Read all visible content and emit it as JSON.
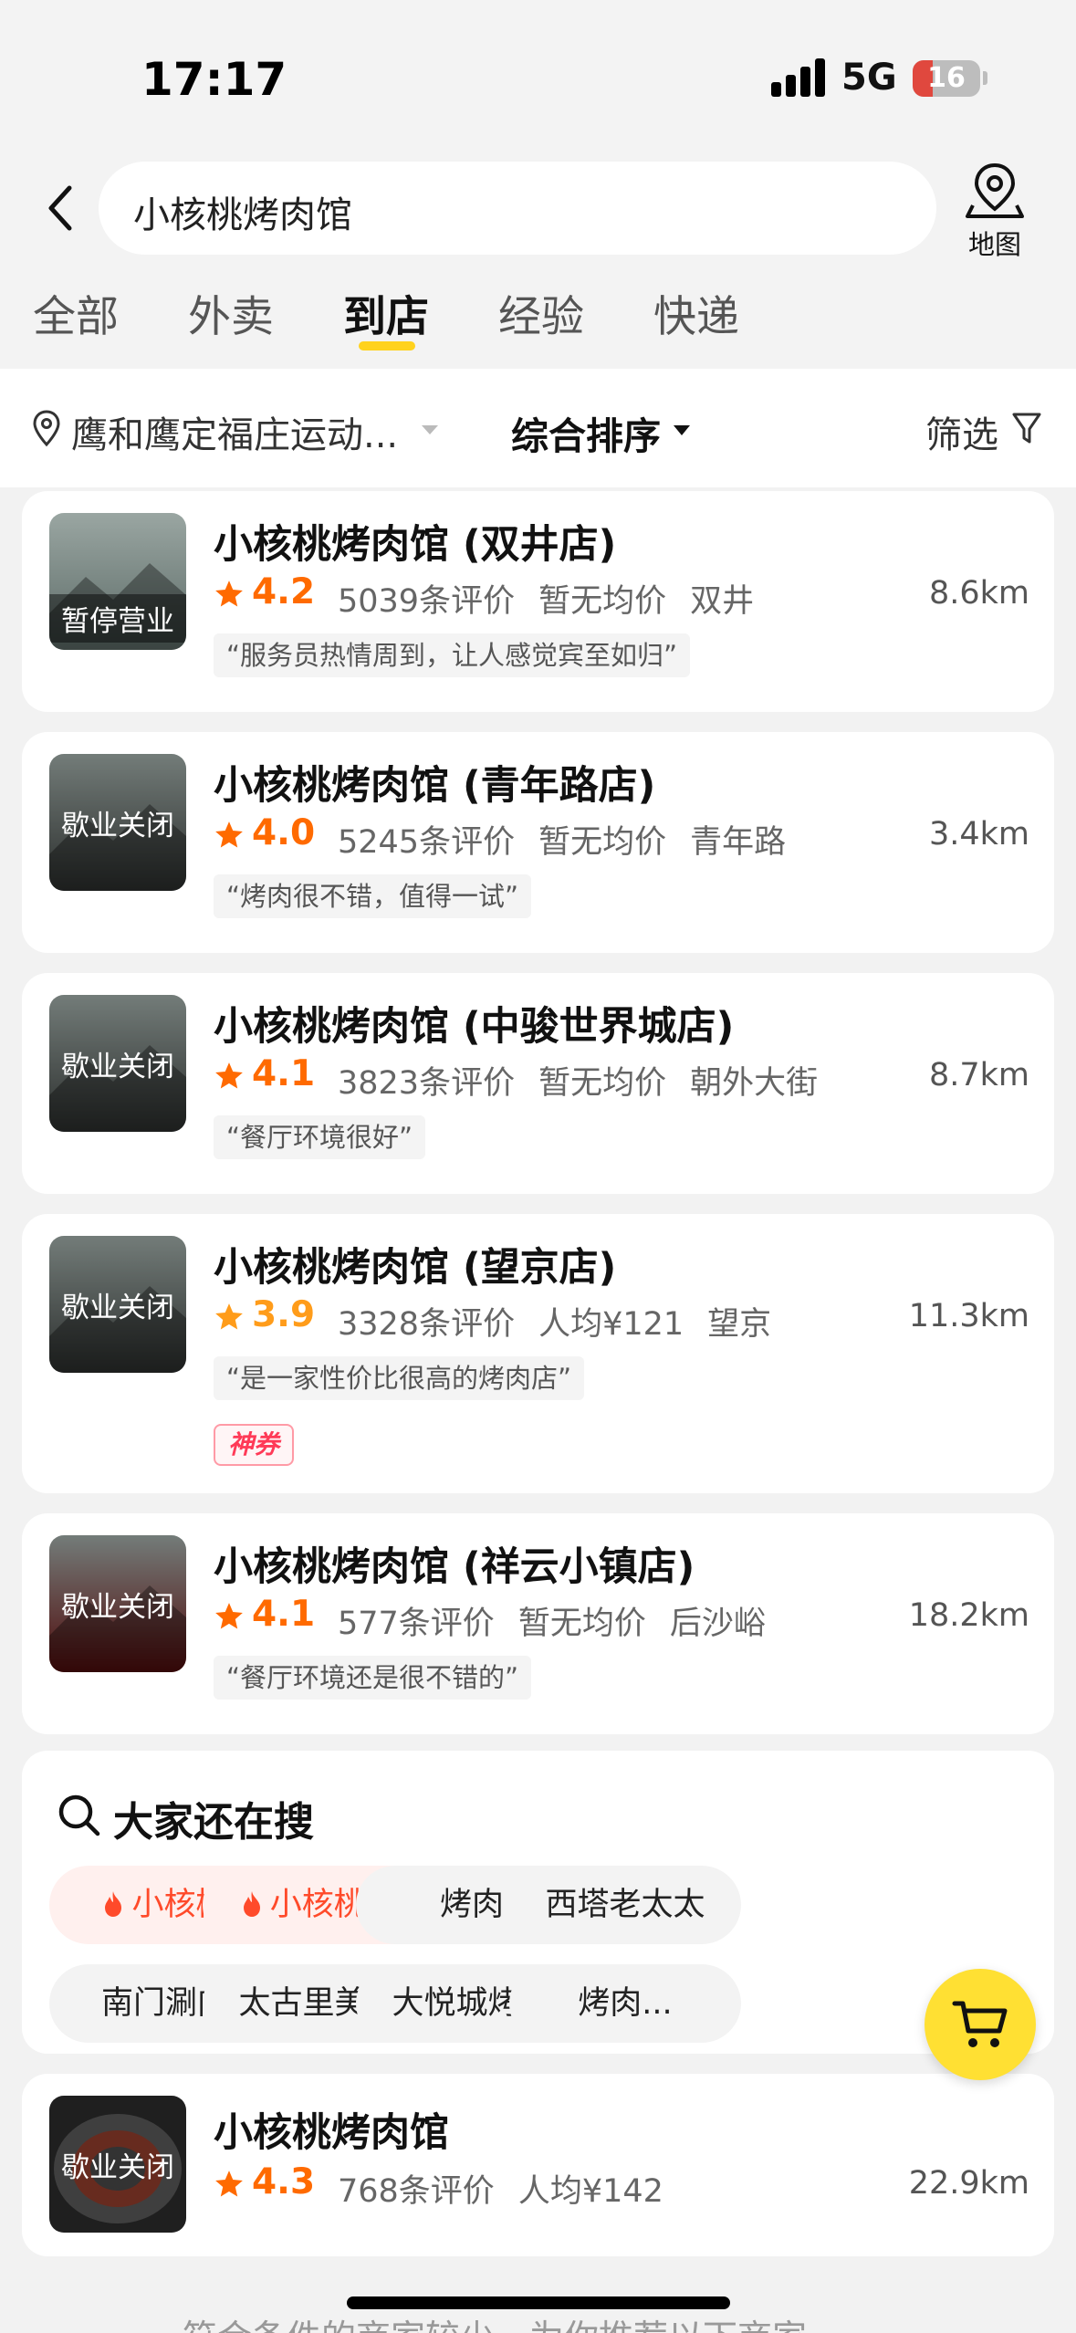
{
  "status_bar": {
    "time": "17:17",
    "network": "5G",
    "battery": "16"
  },
  "search": {
    "query": "小核桃烤肉馆",
    "map_label": "地图"
  },
  "tabs": [
    {
      "label": "全部"
    },
    {
      "label": "外卖"
    },
    {
      "label": "到店",
      "active": true
    },
    {
      "label": "经验"
    },
    {
      "label": "快递"
    }
  ],
  "filters": {
    "location": "鹰和鹰定福庄运动...",
    "sort": "综合排序",
    "filter": "筛选"
  },
  "results": [
    {
      "name": "小核桃烤肉馆 (双井店)",
      "rating": "4.2",
      "rating_color": "#ff6a00",
      "reviews": "5039条评价",
      "price": "暂无均价",
      "area": "双井",
      "distance": "8.6km",
      "quote": "“服务员热情周到，让人感觉宾至如归”",
      "status": "暂停营业",
      "thumb_color": "#5b6a66"
    },
    {
      "name": "小核桃烤肉馆 (青年路店)",
      "rating": "4.0",
      "rating_color": "#ff6a00",
      "reviews": "5245条评价",
      "price": "暂无均价",
      "area": "青年路",
      "distance": "3.4km",
      "quote": "“烤肉很不错，值得一试”",
      "status": "歇业关闭",
      "thumb_color": "#3b3f3d"
    },
    {
      "name": "小核桃烤肉馆 (中骏世界城店)",
      "rating": "4.1",
      "rating_color": "#ff6a00",
      "reviews": "3823条评价",
      "price": "暂无均价",
      "area": "朝外大街",
      "distance": "8.7km",
      "quote": "“餐厅环境很好”",
      "status": "歇业关闭",
      "thumb_color": "#3b3f3d"
    },
    {
      "name": "小核桃烤肉馆 (望京店)",
      "rating": "3.9",
      "rating_color": "#ff9c1a",
      "reviews": "3328条评价",
      "price": "人均¥121",
      "area": "望京",
      "distance": "11.3km",
      "quote": "“是一家性价比很高的烤肉店”",
      "status": "歇业关闭",
      "badge": "神券",
      "thumb_color": "#3b3f3d"
    },
    {
      "name": "小核桃烤肉馆 (祥云小镇店)",
      "rating": "4.1",
      "rating_color": "#ff6a00",
      "reviews": "577条评价",
      "price": "暂无均价",
      "area": "后沙峪",
      "distance": "18.2km",
      "quote": "“餐厅环境还是很不错的”",
      "status": "歇业关闭",
      "thumb_color": "#6a1010"
    }
  ],
  "hot_search": {
    "title": "大家还在搜",
    "chips": [
      {
        "label": "小核桃",
        "hot": true
      },
      {
        "label": "小核桃...",
        "hot": true
      },
      {
        "label": "烤肉"
      },
      {
        "label": "西塔老太太"
      },
      {
        "label": "南门涮肉"
      },
      {
        "label": "太古里美食"
      },
      {
        "label": "大悦城烤肉"
      },
      {
        "label": "烤肉..."
      }
    ]
  },
  "last_result": {
    "name": "小核桃烤肉馆",
    "rating": "4.3",
    "reviews": "768条评价",
    "price": "人均¥142",
    "distance": "22.9km",
    "status": "歇业关闭"
  },
  "footer_text": "符合条件的商家较少，为你推荐以下商家"
}
